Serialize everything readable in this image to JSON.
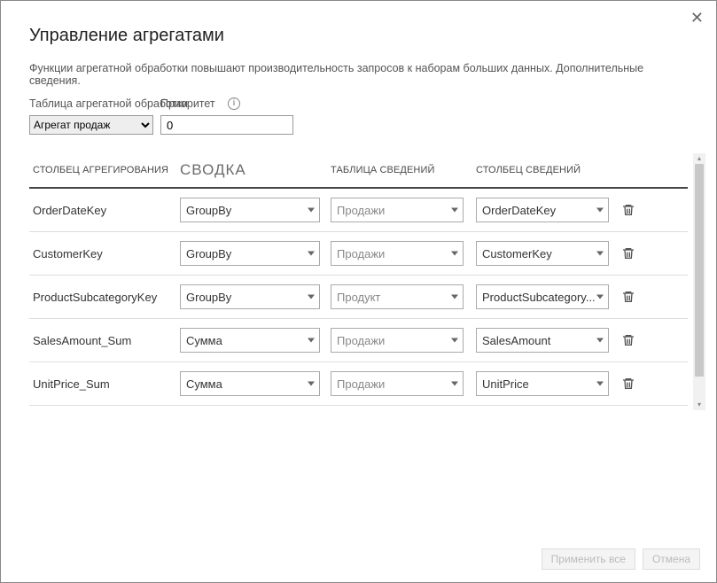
{
  "dialog": {
    "title": "Управление агрегатами",
    "description": "Функции агрегатной обработки повышают производительность запросов к наборам больших данных. Дополнительные сведения.",
    "close_glyph": "✕"
  },
  "controls": {
    "table_label": "Таблица агрегатной обработки",
    "table_value": "Агрегат продаж",
    "priority_label": "Приоритет",
    "priority_value": "0",
    "info_glyph": "i"
  },
  "headers": {
    "aggregation_column": "СТОЛБЕЦ АГРЕГИРОВАНИЯ",
    "summary": "СВОДКА",
    "detail_table": "ТАБЛИЦА СВЕДЕНИЙ",
    "detail_column": "СТОЛБЕЦ СВЕДЕНИЙ"
  },
  "rows": [
    {
      "agg_col": "OrderDateKey",
      "summary": "GroupBy",
      "detail_table": "Продажи",
      "detail_table_faded": true,
      "detail_col": "OrderDateKey"
    },
    {
      "agg_col": "CustomerKey",
      "summary": "GroupBy",
      "detail_table": "Продажи",
      "detail_table_faded": true,
      "detail_col": "CustomerKey"
    },
    {
      "agg_col": "ProductSubcategoryKey",
      "summary": "GroupBy",
      "detail_table": "Продукт",
      "detail_table_faded": true,
      "detail_col": "ProductSubcategory..."
    },
    {
      "agg_col": "SalesAmount_Sum",
      "summary": "Сумма",
      "detail_table": "Продажи",
      "detail_table_faded": true,
      "detail_col": "SalesAmount"
    },
    {
      "agg_col": "UnitPrice_Sum",
      "summary": "Сумма",
      "detail_table": "Продажи",
      "detail_table_faded": true,
      "detail_col": "UnitPrice"
    }
  ],
  "footer": {
    "apply": "Применить все",
    "cancel": "Отмена"
  }
}
